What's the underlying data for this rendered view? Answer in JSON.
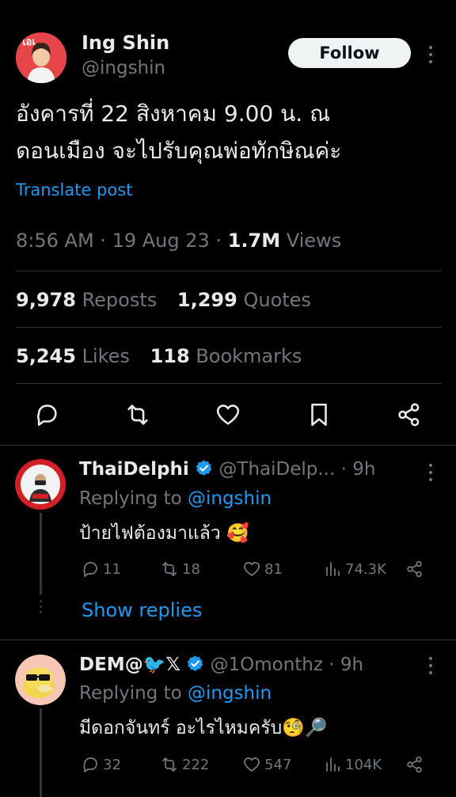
{
  "main_tweet": {
    "author_name": "Ing Shin",
    "author_handle": "@ingshin",
    "follow_label": "Follow",
    "text_line1": "อังคารที่ 22 สิงหาคม 9.00 น. ณ",
    "text_line2": "ดอนเมือง จะไปรับคุณพ่อทักษิณค่ะ",
    "translate_label": "Translate post",
    "time": "8:56 AM",
    "sep": "·",
    "date": "19 Aug 23",
    "views_count": "1.7M",
    "views_label": "Views",
    "reposts_count": "9,978",
    "reposts_label": "Reposts",
    "quotes_count": "1,299",
    "quotes_label": "Quotes",
    "likes_count": "5,245",
    "likes_label": "Likes",
    "bookmarks_count": "118",
    "bookmarks_label": "Bookmarks",
    "actions": [
      "reply-icon",
      "repost-icon",
      "like-icon",
      "bookmark-icon",
      "share-icon"
    ]
  },
  "replies": [
    {
      "name": "ThaiDelphi",
      "handle": "@ThaiDelp...",
      "time": "· 9h",
      "replying_prefix": "Replying to",
      "replying_to": "@ingshin",
      "text": "ป้ายไฟต้องมาแล้ว 🥰",
      "replies": "11",
      "reposts": "18",
      "likes": "81",
      "views": "74.3K",
      "show_replies": "Show replies"
    },
    {
      "name": "DEM@🐦𝕏",
      "handle": "@1Omonthz",
      "time": "· 9h",
      "replying_prefix": "Replying to",
      "replying_to": "@ingshin",
      "text": "มีดอกจันทร์ อะไรไหมครับ🧐🔎",
      "replies": "32",
      "reposts": "222",
      "likes": "547",
      "views": "104K"
    }
  ],
  "colors": {
    "background": "#000000",
    "text": "#e7e9ea",
    "muted": "#71767b",
    "link": "#1d9bf0",
    "divider": "#2f3336",
    "verified": "#1d9bf0"
  }
}
